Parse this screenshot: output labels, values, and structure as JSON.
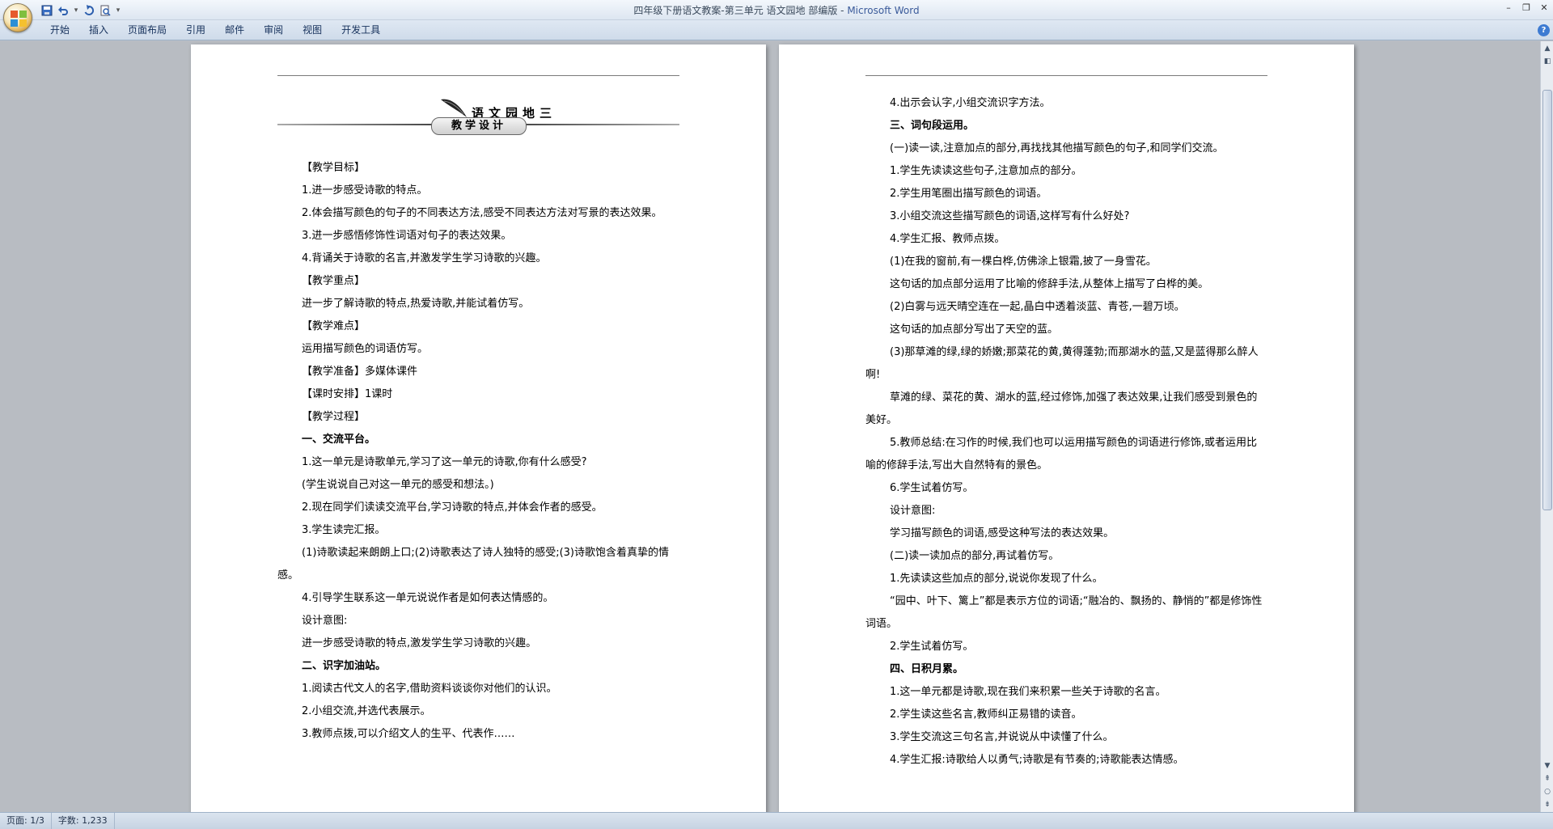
{
  "window": {
    "title": "四年级下册语文教案-第三单元 语文园地 部编版",
    "separator": " - ",
    "app_name": "Microsoft Word",
    "controls": [
      "–",
      "❐",
      "✕"
    ]
  },
  "quick_access": [
    "save-icon",
    "undo-icon",
    "redo-icon",
    "print-preview-icon",
    "customize-icon"
  ],
  "ribbon": {
    "tabs": [
      "开始",
      "插入",
      "页面布局",
      "引用",
      "邮件",
      "审阅",
      "视图",
      "开发工具"
    ]
  },
  "banner": {
    "title": "语文园地三",
    "tag": "教学设计"
  },
  "left_page": [
    {
      "text": "【教学目标】",
      "style": "p"
    },
    {
      "text": "1.进一步感受诗歌的特点。",
      "style": "p"
    },
    {
      "text": "2.体会描写颜色的句子的不同表达方法,感受不同表达方法对写景的表达效果。",
      "style": "p"
    },
    {
      "text": "3.进一步感悟修饰性词语对句子的表达效果。",
      "style": "p"
    },
    {
      "text": "4.背诵关于诗歌的名言,并激发学生学习诗歌的兴趣。",
      "style": "p"
    },
    {
      "text": "【教学重点】",
      "style": "p"
    },
    {
      "text": "进一步了解诗歌的特点,热爱诗歌,并能试着仿写。",
      "style": "p"
    },
    {
      "text": "【教学难点】",
      "style": "p"
    },
    {
      "text": "运用描写颜色的词语仿写。",
      "style": "p"
    },
    {
      "text": "【教学准备】多媒体课件",
      "style": "p"
    },
    {
      "text": "【课时安排】1课时",
      "style": "p"
    },
    {
      "text": "【教学过程】",
      "style": "p"
    },
    {
      "text": "一、交流平台。",
      "style": "p bold"
    },
    {
      "text": "1.这一单元是诗歌单元,学习了这一单元的诗歌,你有什么感受?",
      "style": "p"
    },
    {
      "text": "(学生说说自己对这一单元的感受和想法。)",
      "style": "p"
    },
    {
      "text": "2.现在同学们读读交流平台,学习诗歌的特点,并体会作者的感受。",
      "style": "p"
    },
    {
      "text": "3.学生读完汇报。",
      "style": "p"
    },
    {
      "text": "(1)诗歌读起来朗朗上口;(2)诗歌表达了诗人独特的感受;(3)诗歌饱含着真挚的情感。",
      "style": "p"
    },
    {
      "text": "4.引导学生联系这一单元说说作者是如何表达情感的。",
      "style": "p"
    },
    {
      "text": "设计意图:",
      "style": "p"
    },
    {
      "text": "进一步感受诗歌的特点,激发学生学习诗歌的兴趣。",
      "style": "p"
    },
    {
      "text": "二、识字加油站。",
      "style": "p bold"
    },
    {
      "text": "1.阅读古代文人的名字,借助资料谈谈你对他们的认识。",
      "style": "p"
    },
    {
      "text": "2.小组交流,并选代表展示。",
      "style": "p"
    },
    {
      "text": "3.教师点拨,可以介绍文人的生平、代表作……",
      "style": "p"
    }
  ],
  "right_page": [
    {
      "text": "4.出示会认字,小组交流识字方法。",
      "style": "p"
    },
    {
      "text": "三、词句段运用。",
      "style": "p bold"
    },
    {
      "text": "(一)读一读,注意加点的部分,再找找其他描写颜色的句子,和同学们交流。",
      "style": "p"
    },
    {
      "text": "1.学生先读读这些句子,注意加点的部分。",
      "style": "p"
    },
    {
      "text": "2.学生用笔圈出描写颜色的词语。",
      "style": "p"
    },
    {
      "text": "3.小组交流这些描写颜色的词语,这样写有什么好处?",
      "style": "p"
    },
    {
      "text": "4.学生汇报、教师点拨。",
      "style": "p"
    },
    {
      "text": "(1)在我的窗前,有一棵白桦,仿佛涂上银霜,披了一身雪花。",
      "style": "p"
    },
    {
      "text": "这句话的加点部分运用了比喻的修辞手法,从整体上描写了白桦的美。",
      "style": "p"
    },
    {
      "text": "(2)白雾与远天晴空连在一起,晶白中透着淡蓝、青苍,一碧万顷。",
      "style": "p"
    },
    {
      "text": "这句话的加点部分写出了天空的蓝。",
      "style": "p"
    },
    {
      "text": "(3)那草滩的绿,绿的娇嫩;那菜花的黄,黄得蓬勃;而那湖水的蓝,又是蓝得那么醉人啊!",
      "style": "p"
    },
    {
      "text": "草滩的绿、菜花的黄、湖水的蓝,经过修饰,加强了表达效果,让我们感受到景色的美好。",
      "style": "p"
    },
    {
      "text": "5.教师总结:在习作的时候,我们也可以运用描写颜色的词语进行修饰,或者运用比喻的修辞手法,写出大自然特有的景色。",
      "style": "p"
    },
    {
      "text": "6.学生试着仿写。",
      "style": "p"
    },
    {
      "text": "设计意图:",
      "style": "p"
    },
    {
      "text": "学习描写颜色的词语,感受这种写法的表达效果。",
      "style": "p"
    },
    {
      "text": "(二)读一读加点的部分,再试着仿写。",
      "style": "p"
    },
    {
      "text": "1.先读读这些加点的部分,说说你发现了什么。",
      "style": "p"
    },
    {
      "text": "“园中、叶下、篱上”都是表示方位的词语;“融冶的、飘扬的、静悄的”都是修饰性词语。",
      "style": "p"
    },
    {
      "text": "2.学生试着仿写。",
      "style": "p"
    },
    {
      "text": "四、日积月累。",
      "style": "p bold"
    },
    {
      "text": "1.这一单元都是诗歌,现在我们来积累一些关于诗歌的名言。",
      "style": "p"
    },
    {
      "text": "2.学生读这些名言,教师纠正易错的读音。",
      "style": "p"
    },
    {
      "text": "3.学生交流这三句名言,并说说从中读懂了什么。",
      "style": "p"
    },
    {
      "text": "4.学生汇报:诗歌给人以勇气;诗歌是有节奏的;诗歌能表达情感。",
      "style": "p"
    }
  ],
  "status": {
    "page": "页面: 1/3",
    "words": "字数: 1,233"
  }
}
